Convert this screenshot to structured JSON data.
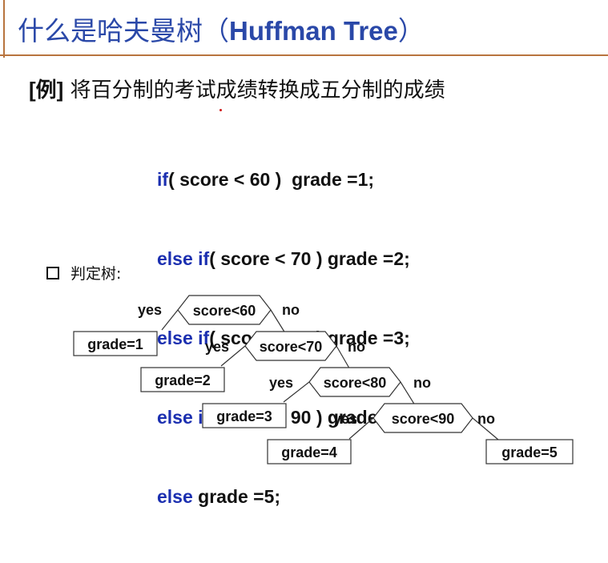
{
  "title": {
    "zh": "什么是哈夫曼树（",
    "en": "Huffman Tree",
    "close": "）"
  },
  "example": {
    "tag": "[例]",
    "text": "将百分制的考试成绩转换成五分制的成绩"
  },
  "code": [
    {
      "kw1": "if",
      "kw2": "",
      "rest": "( score < 60 )  grade =1;"
    },
    {
      "kw1": "else ",
      "kw2": "if",
      "rest": "( score < 70 ) grade =2;"
    },
    {
      "kw1": "else ",
      "kw2": "if",
      "rest": "( score < 80 ) grade =3;"
    },
    {
      "kw1": "else ",
      "kw2": "if",
      "rest": "( score < 90 ) grade =4;"
    },
    {
      "kw1": "else",
      "kw2": "",
      "rest": " grade =5;"
    }
  ],
  "decision_tree": {
    "heading": "判定树:",
    "decisions": [
      "score<60",
      "score<70",
      "score<80",
      "score<90"
    ],
    "yes_label": "yes",
    "no_label": "no",
    "results": [
      "grade=1",
      "grade=2",
      "grade=3",
      "grade=4",
      "grade=5"
    ]
  },
  "colors": {
    "title": "#2a48a8",
    "keyword": "#1b2fb0",
    "rule": "#b8743e",
    "text": "#111111"
  }
}
